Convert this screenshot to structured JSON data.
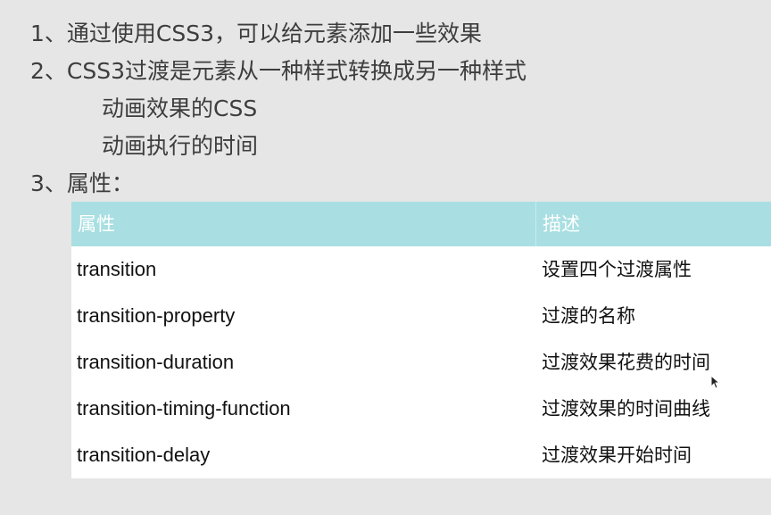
{
  "lines": {
    "l1": "1、通过使用CSS3，可以给元素添加一些效果",
    "l2": "2、CSS3过渡是元素从一种样式转换成另一种样式",
    "l2a": "动画效果的CSS",
    "l2b": "动画执行的时间",
    "l3": "3、属性："
  },
  "table": {
    "headers": [
      "属性",
      "描述"
    ],
    "rows": [
      [
        "transition",
        "设置四个过渡属性"
      ],
      [
        "transition-property",
        "过渡的名称"
      ],
      [
        "transition-duration",
        "过渡效果花费的时间"
      ],
      [
        "transition-timing-function",
        "过渡效果的时间曲线"
      ],
      [
        "transition-delay",
        "过渡效果开始时间"
      ]
    ]
  },
  "icons": {
    "cursor": "mouse-pointer-icon"
  },
  "colors": {
    "background": "#e6e6e6",
    "header_bg": "#a9dfe2",
    "header_text": "#ffffff",
    "body_text": "#3d3d3d"
  }
}
